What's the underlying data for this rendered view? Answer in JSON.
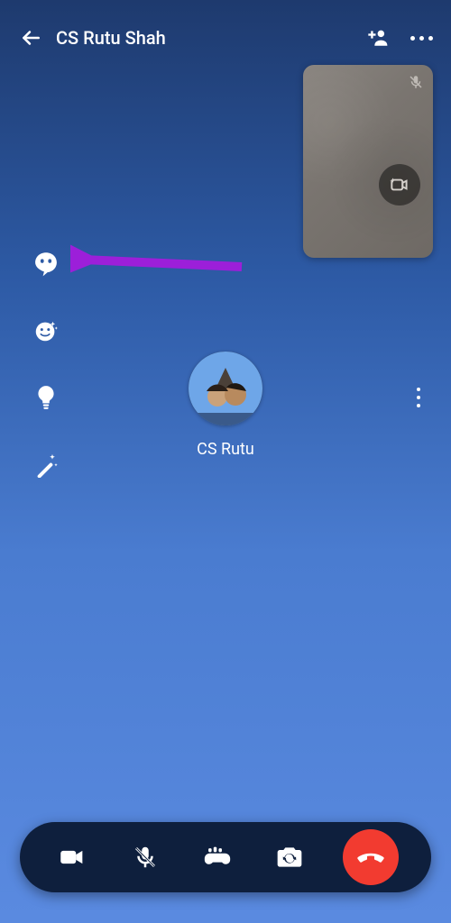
{
  "header": {
    "title": "CS Rutu Shah"
  },
  "pip": {
    "muted": true,
    "effect_icon": "video-effect-icon"
  },
  "side_effects": {
    "items": [
      {
        "name": "avatar-effect-icon"
      },
      {
        "name": "face-sticker-icon"
      },
      {
        "name": "lighting-icon"
      },
      {
        "name": "magic-wand-icon"
      }
    ]
  },
  "participant": {
    "name": "CS Rutu"
  },
  "bottombar": {
    "items": [
      {
        "name": "video-toggle-icon"
      },
      {
        "name": "mic-muted-icon"
      },
      {
        "name": "games-icon"
      },
      {
        "name": "flip-camera-icon"
      }
    ],
    "end": "end-call-icon"
  },
  "annotation": {
    "arrow_color": "#9c1fd9"
  }
}
